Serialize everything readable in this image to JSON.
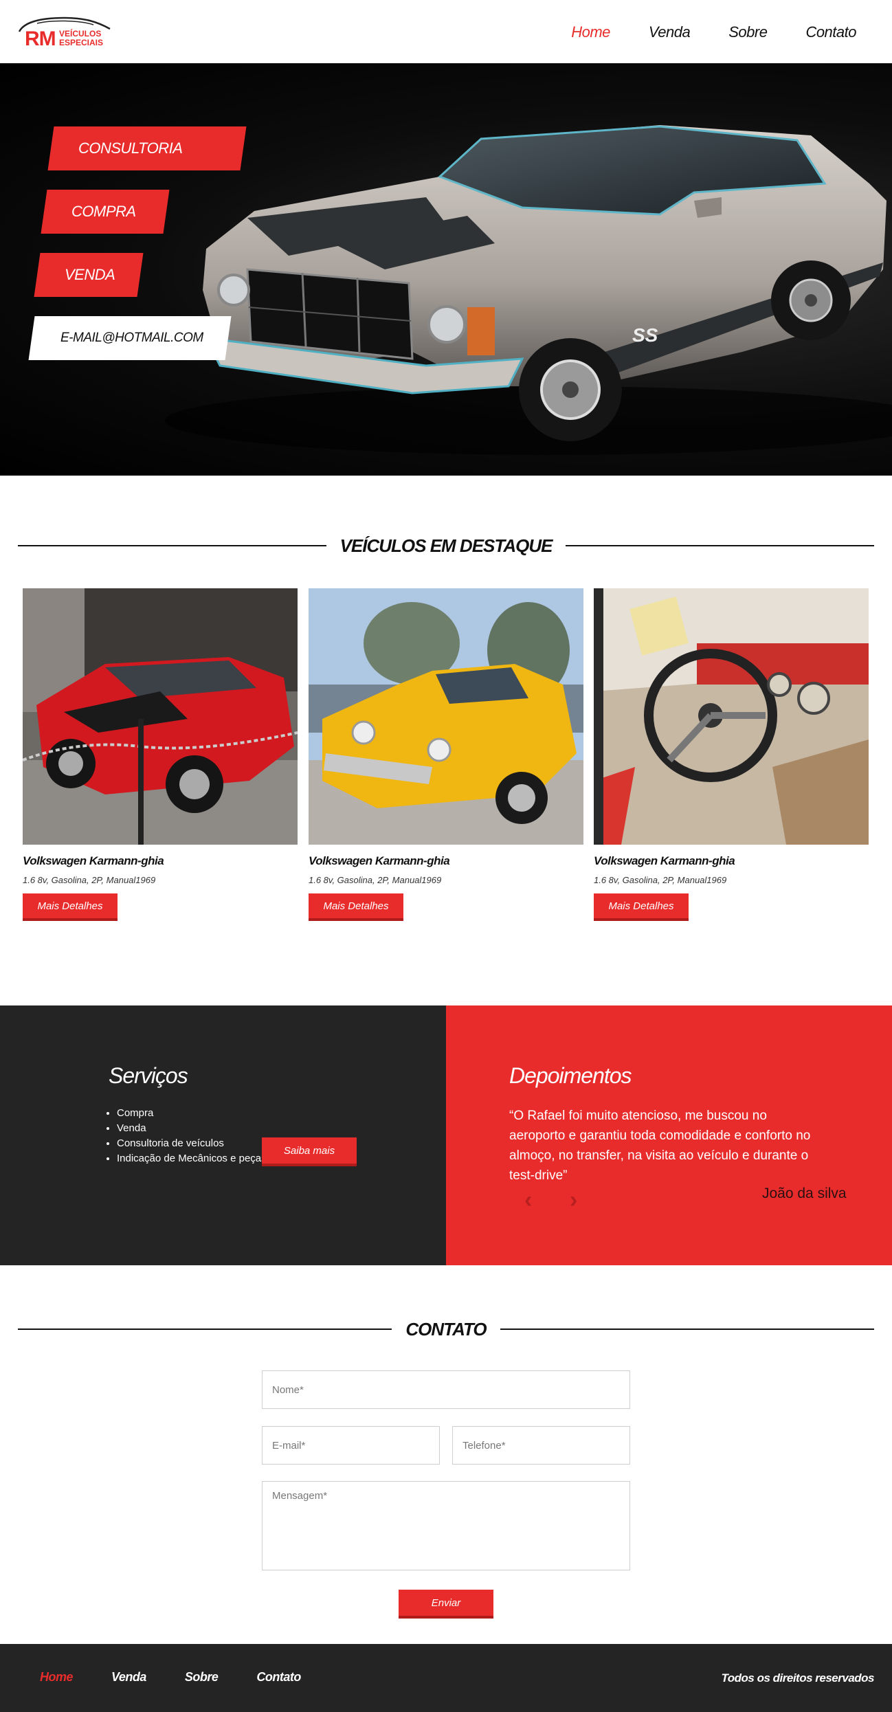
{
  "header": {
    "logo": {
      "mark": "RM",
      "line1": "VEÍCULOS",
      "line2": "ESPECIAIS"
    },
    "nav": [
      {
        "label": "Home",
        "active": true
      },
      {
        "label": "Venda",
        "active": false
      },
      {
        "label": "Sobre",
        "active": false
      },
      {
        "label": "Contato",
        "active": false
      }
    ]
  },
  "hero": {
    "tags": [
      "CONSULTORIA",
      "COMPRA",
      "VENDA",
      "E-MAIL@HOTMAIL.COM"
    ]
  },
  "featured": {
    "title": "VEÍCULOS EM DESTAQUE",
    "cards": [
      {
        "name": "Volkswagen Karmann-ghia",
        "spec": "1.6 8v, Gasolina, 2P, Manual1969",
        "button": "Mais Detalhes",
        "image": "red-classic-car"
      },
      {
        "name": "Volkswagen Karmann-ghia",
        "spec": "1.6 8v, Gasolina, 2P, Manual1969",
        "button": "Mais Detalhes",
        "image": "yellow-classic-car"
      },
      {
        "name": "Volkswagen Karmann-ghia",
        "spec": "1.6 8v, Gasolina, 2P, Manual1969",
        "button": "Mais Detalhes",
        "image": "car-interior-steering-wheel"
      }
    ]
  },
  "services": {
    "title": "Serviços",
    "items": [
      "Compra",
      "Venda",
      "Consultoria de veículos",
      "Indicação de Mecânicos e peças"
    ],
    "button": "Saiba mais"
  },
  "testimonials": {
    "title": "Depoimentos",
    "quote": "“O Rafael foi muito atencioso, me buscou no aeroporto e garantiu toda comodidade e conforto no almoço, no transfer, na visita ao veículo e durante o test-drive”",
    "author": "João da silva",
    "prev_icon": "chevron-left-icon",
    "next_icon": "chevron-right-icon"
  },
  "contact": {
    "title": "CONTATO",
    "name_placeholder": "Nome*",
    "email_placeholder": "E-mail*",
    "phone_placeholder": "Telefone*",
    "message_placeholder": "Mensagem*",
    "submit": "Enviar"
  },
  "footer": {
    "nav": [
      "Home",
      "Venda",
      "Sobre",
      "Contato"
    ],
    "rights": "Todos os direitos reservados"
  },
  "colors": {
    "accent": "#e82c2c",
    "dark": "#242424"
  }
}
